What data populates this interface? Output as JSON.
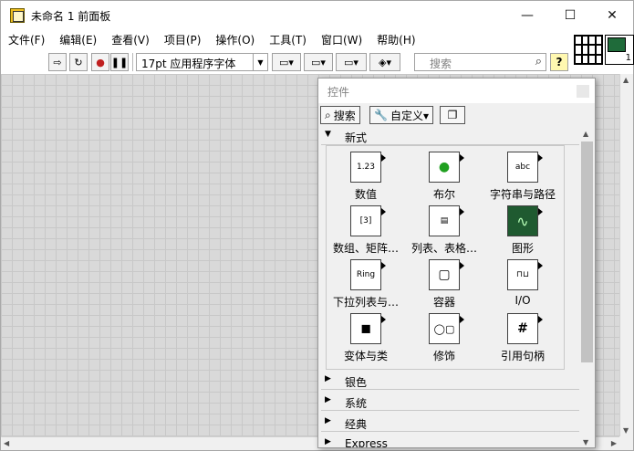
{
  "window": {
    "title": "未命名 1 前面板",
    "controls": {
      "minimize": "—",
      "maximize": "☐",
      "close": "✕"
    }
  },
  "menubar": {
    "items": [
      "文件(F)",
      "编辑(E)",
      "查看(V)",
      "项目(P)",
      "操作(O)",
      "工具(T)",
      "窗口(W)",
      "帮助(H)"
    ]
  },
  "toolbar": {
    "run_icon": "⇨",
    "run_continuous_icon": "↻",
    "abort_icon": "●",
    "pause_icon": "❚❚",
    "font_label": "17pt 应用程序字体",
    "align_icon": "▭▾",
    "distribute_icon": "▭▾",
    "resize_icon": "▭▾",
    "reorder_icon": "◈▾",
    "search_placeholder": "搜索",
    "help_label": "?"
  },
  "vi_icon": {
    "number": "1"
  },
  "palette": {
    "title": "控件",
    "search_label": "搜索",
    "customize_label": "自定义▾",
    "sections": [
      {
        "label": "新式",
        "expanded": true
      },
      {
        "label": "银色",
        "expanded": false
      },
      {
        "label": "系统",
        "expanded": false
      },
      {
        "label": "经典",
        "expanded": false
      },
      {
        "label": "Express",
        "expanded": false
      }
    ],
    "items": [
      {
        "label": "数值",
        "glyph": "1.23"
      },
      {
        "label": "布尔",
        "glyph": "●"
      },
      {
        "label": "字符串与路径",
        "glyph": "abc"
      },
      {
        "label": "数组、矩阵…",
        "glyph": "[3]"
      },
      {
        "label": "列表、表格…",
        "glyph": "▤"
      },
      {
        "label": "图形",
        "glyph": "∿"
      },
      {
        "label": "下拉列表与…",
        "glyph": "Ring"
      },
      {
        "label": "容器",
        "glyph": "▢"
      },
      {
        "label": "I/O",
        "glyph": "⊓⊔"
      },
      {
        "label": "变体与类",
        "glyph": "◼"
      },
      {
        "label": "修饰",
        "glyph": "◯▢"
      },
      {
        "label": "引用句柄",
        "glyph": "#"
      }
    ]
  }
}
